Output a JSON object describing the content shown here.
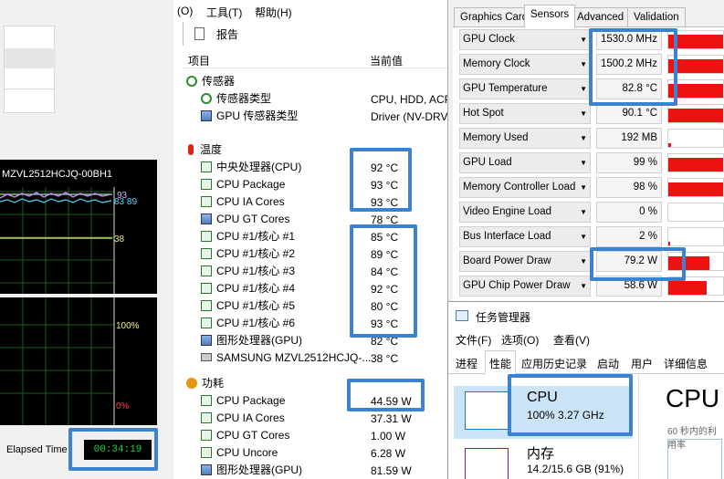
{
  "left_panel": {
    "drive_label": "MZVL2512HCJQ-00BH1",
    "graph1": {
      "ticks": [
        "93",
        "83 89",
        "38"
      ]
    },
    "graph2": {
      "ticks": [
        "100%",
        "0%"
      ]
    },
    "elapsed_label": "Elapsed Time",
    "elapsed_value": "00:34:19"
  },
  "sensor_window": {
    "menu": [
      "(O)",
      "工具(T)",
      "帮助(H)"
    ],
    "toolbar_report": "报告",
    "col_item": "项目",
    "col_value": "当前值",
    "sections": [
      {
        "title": "传感器",
        "icon": "sensor-icon",
        "rows": [
          {
            "label": "传感器类型",
            "value": "CPU, HDD, ACP",
            "icon": "sensor-type-icon"
          },
          {
            "label": "GPU 传感器类型",
            "value": "Driver (NV-DRV",
            "icon": "gpu-icon"
          }
        ]
      },
      {
        "title": "温度",
        "icon": "thermometer-icon",
        "rows": [
          {
            "label": "中央处理器(CPU)",
            "value": "92 °C",
            "icon": "chip-icon"
          },
          {
            "label": "CPU Package",
            "value": "93 °C",
            "icon": "chip-icon"
          },
          {
            "label": "CPU IA Cores",
            "value": "93 °C",
            "icon": "chip-icon"
          },
          {
            "label": "CPU GT Cores",
            "value": "78 °C",
            "icon": "gpu-icon"
          },
          {
            "label": "CPU #1/核心 #1",
            "value": "85 °C",
            "icon": "chip-icon"
          },
          {
            "label": "CPU #1/核心 #2",
            "value": "89 °C",
            "icon": "chip-icon"
          },
          {
            "label": "CPU #1/核心 #3",
            "value": "84 °C",
            "icon": "chip-icon"
          },
          {
            "label": "CPU #1/核心 #4",
            "value": "92 °C",
            "icon": "chip-icon"
          },
          {
            "label": "CPU #1/核心 #5",
            "value": "80 °C",
            "icon": "chip-icon"
          },
          {
            "label": "CPU #1/核心 #6",
            "value": "93 °C",
            "icon": "chip-icon"
          },
          {
            "label": "图形处理器(GPU)",
            "value": "82 °C",
            "icon": "gpu-icon"
          },
          {
            "label": "SAMSUNG MZVL2512HCJQ-...",
            "value": "38 °C",
            "icon": "drive-icon"
          }
        ]
      },
      {
        "title": "功耗",
        "icon": "power-icon",
        "rows": [
          {
            "label": "CPU Package",
            "value": "44.59 W",
            "icon": "chip-icon"
          },
          {
            "label": "CPU IA Cores",
            "value": "37.31 W",
            "icon": "chip-icon"
          },
          {
            "label": "CPU GT Cores",
            "value": "1.00 W",
            "icon": "chip-icon"
          },
          {
            "label": "CPU Uncore",
            "value": "6.28 W",
            "icon": "chip-icon"
          },
          {
            "label": "图形处理器(GPU)",
            "value": "81.59 W",
            "icon": "gpu-icon"
          }
        ]
      }
    ]
  },
  "gpuz": {
    "tabs": [
      "Graphics Card",
      "Sensors",
      "Advanced",
      "Validation"
    ],
    "active_tab": "Sensors",
    "bar_color": "#ee1111",
    "sensors": [
      {
        "name": "GPU Clock",
        "value": "1530.0 MHz",
        "fill": 1.0
      },
      {
        "name": "Memory Clock",
        "value": "1500.2 MHz",
        "fill": 1.0
      },
      {
        "name": "GPU Temperature",
        "value": "82.8 °C",
        "fill": 1.0
      },
      {
        "name": "Hot Spot",
        "value": "90.1 °C",
        "fill": 1.0
      },
      {
        "name": "Memory Used",
        "value": "192 MB",
        "fill": 0.05
      },
      {
        "name": "GPU Load",
        "value": "99 %",
        "fill": 1.0
      },
      {
        "name": "Memory Controller Load",
        "value": "98 %",
        "fill": 1.0
      },
      {
        "name": "Video Engine Load",
        "value": "0 %",
        "fill": 0.0
      },
      {
        "name": "Bus Interface Load",
        "value": "2 %",
        "fill": 0.04
      },
      {
        "name": "Board Power Draw",
        "value": "79.2 W",
        "fill": 0.75
      },
      {
        "name": "GPU Chip Power Draw",
        "value": "58.6 W",
        "fill": 0.7
      }
    ]
  },
  "task_manager": {
    "title": "任务管理器",
    "menu": [
      "文件(F)",
      "选项(O)",
      "查看(V)"
    ],
    "tabs": [
      "进程",
      "性能",
      "应用历史记录",
      "启动",
      "用户",
      "详细信息"
    ],
    "active_tab": "性能",
    "cpu": {
      "label": "CPU",
      "detail": "100%  3.27 GHz"
    },
    "memory": {
      "label": "内存",
      "detail": "14.2/15.6 GB (91%)"
    },
    "main_title": "CPU",
    "main_subtitle": "60 秒内的利用率"
  }
}
